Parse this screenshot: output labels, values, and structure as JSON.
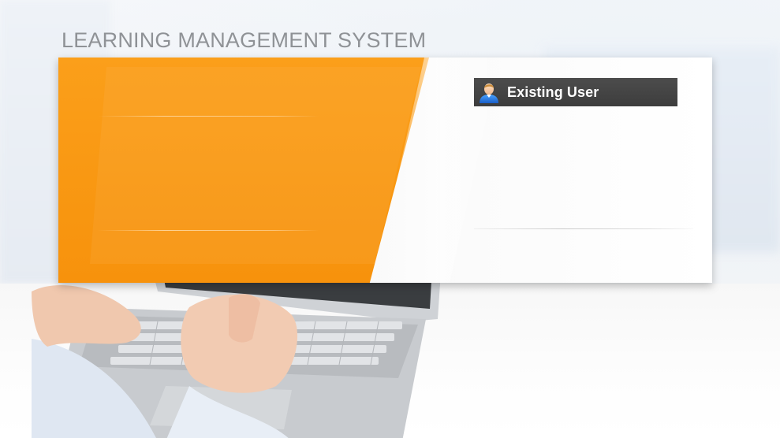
{
  "header": {
    "title": "LEARNING MANAGEMENT SYSTEM"
  },
  "login_panel": {
    "existing_user_label": "Existing User",
    "user_icon": "user-avatar-icon"
  },
  "colors": {
    "accent": "#f7920c",
    "tab_background": "#444444",
    "title_text": "#8f9296"
  }
}
